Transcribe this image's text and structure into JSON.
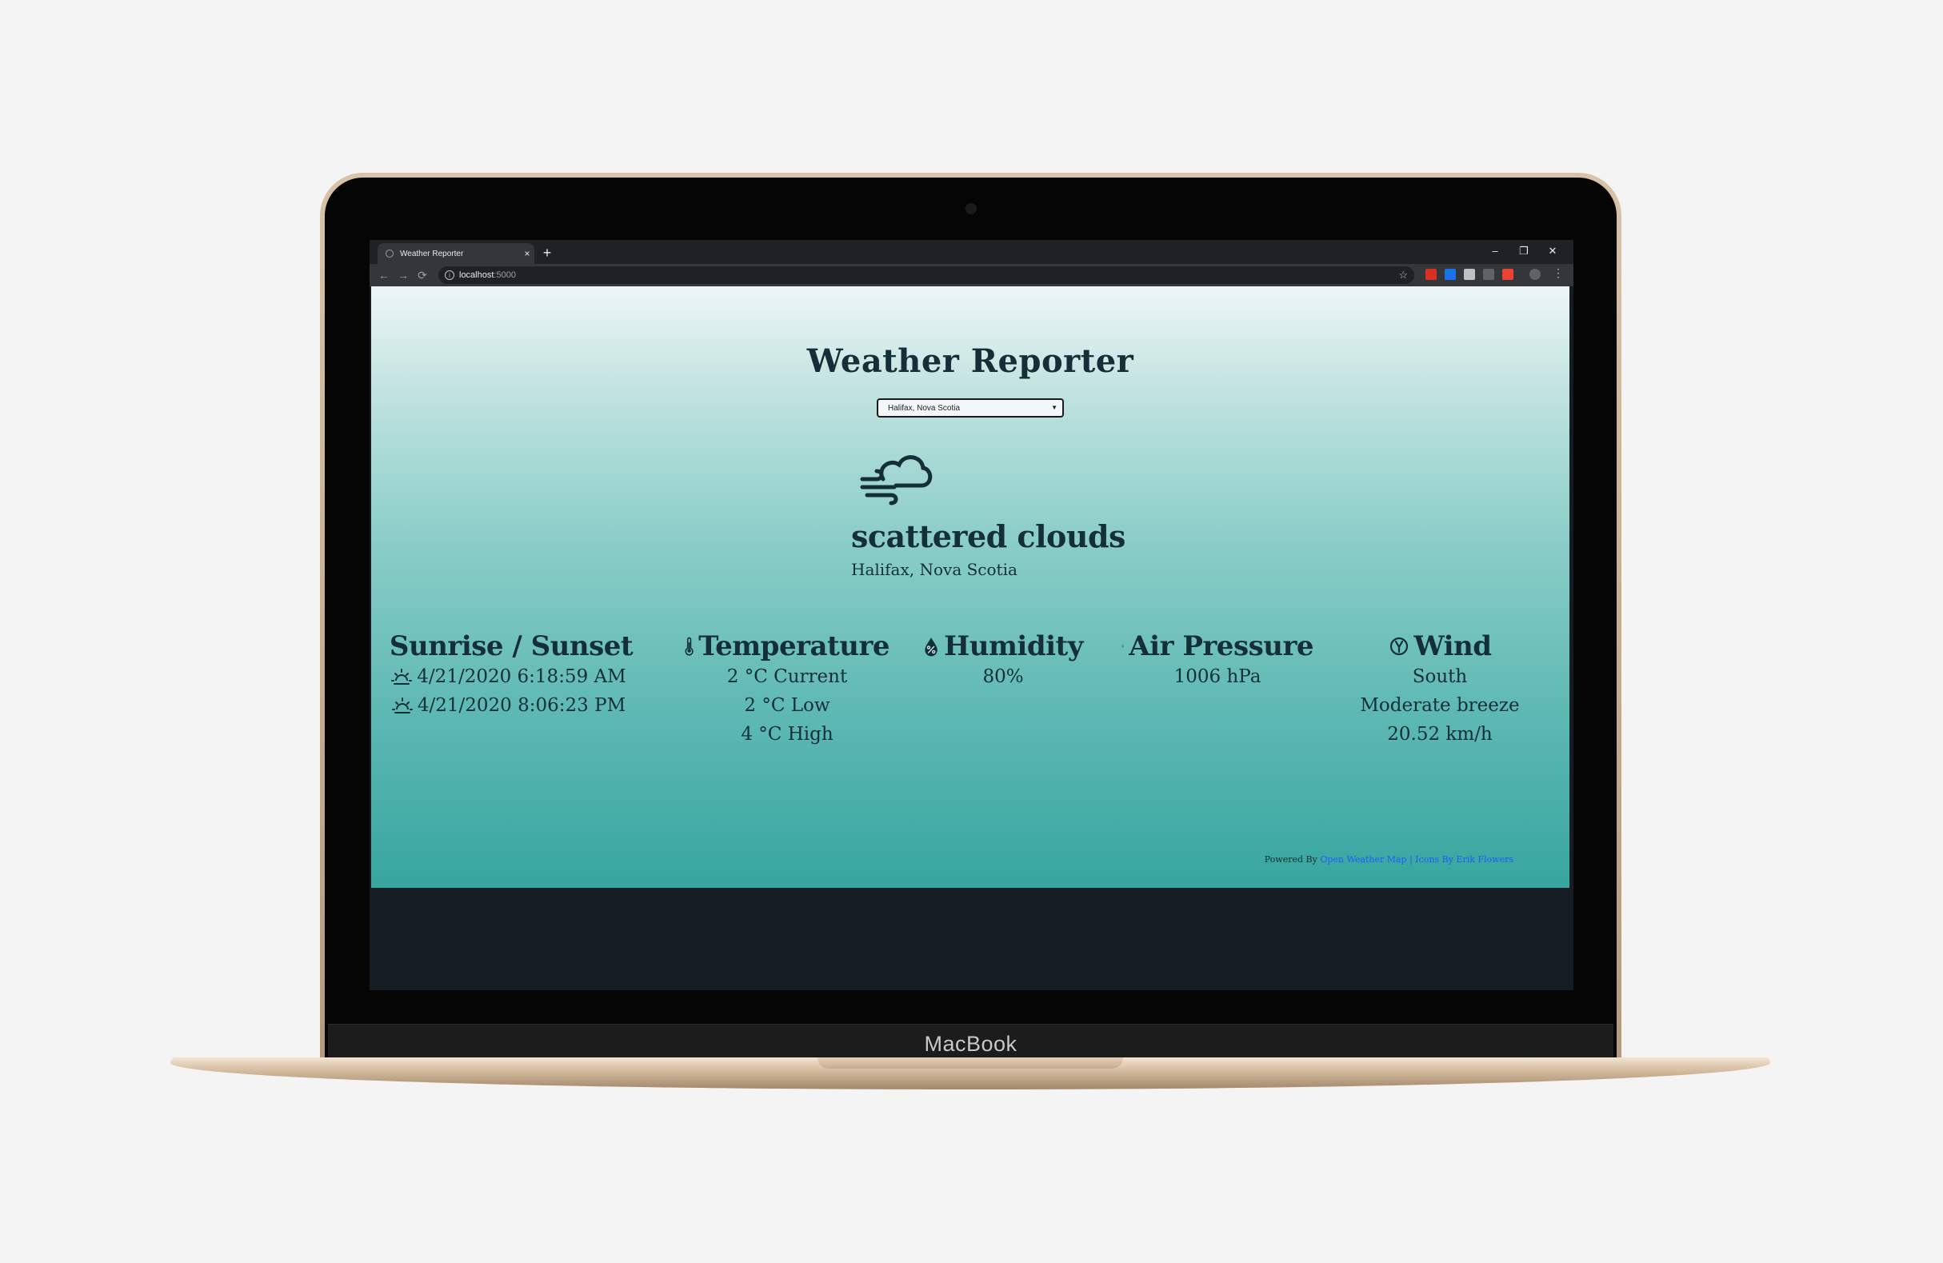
{
  "device": {
    "brand_label": "MacBook"
  },
  "browser": {
    "tab_title": "Weather Reporter",
    "tab_close": "×",
    "new_tab": "+",
    "url_host": "localhost",
    "url_port": ":5000",
    "window_controls": [
      "–",
      "❐",
      "✕"
    ]
  },
  "app": {
    "title": "Weather Reporter",
    "city_select_value": "Halifax, Nova Scotia",
    "condition": "scattered clouds",
    "condition_icon": "cloud-wind-icon",
    "location": "Halifax, Nova Scotia"
  },
  "stats": {
    "sun": {
      "heading": "Sunrise / Sunset",
      "sunrise": "4/21/2020 6:18:59 AM",
      "sunset": "4/21/2020 8:06:23 PM"
    },
    "temperature": {
      "heading": "Temperature",
      "current": "2 °C Current",
      "low": "2 °C Low",
      "high": "4 °C High"
    },
    "humidity": {
      "heading": "Humidity",
      "value": "80%"
    },
    "pressure": {
      "heading": "Air Pressure",
      "value": "1006 hPa"
    },
    "wind": {
      "heading": "Wind",
      "direction": "South",
      "description": "Moderate breeze",
      "speed": "20.52 km/h"
    }
  },
  "footer": {
    "powered_by": "Powered By",
    "owm_link": "Open Weather Map",
    "separator": " | ",
    "icons_link": "Icons By Erik Flowers"
  }
}
